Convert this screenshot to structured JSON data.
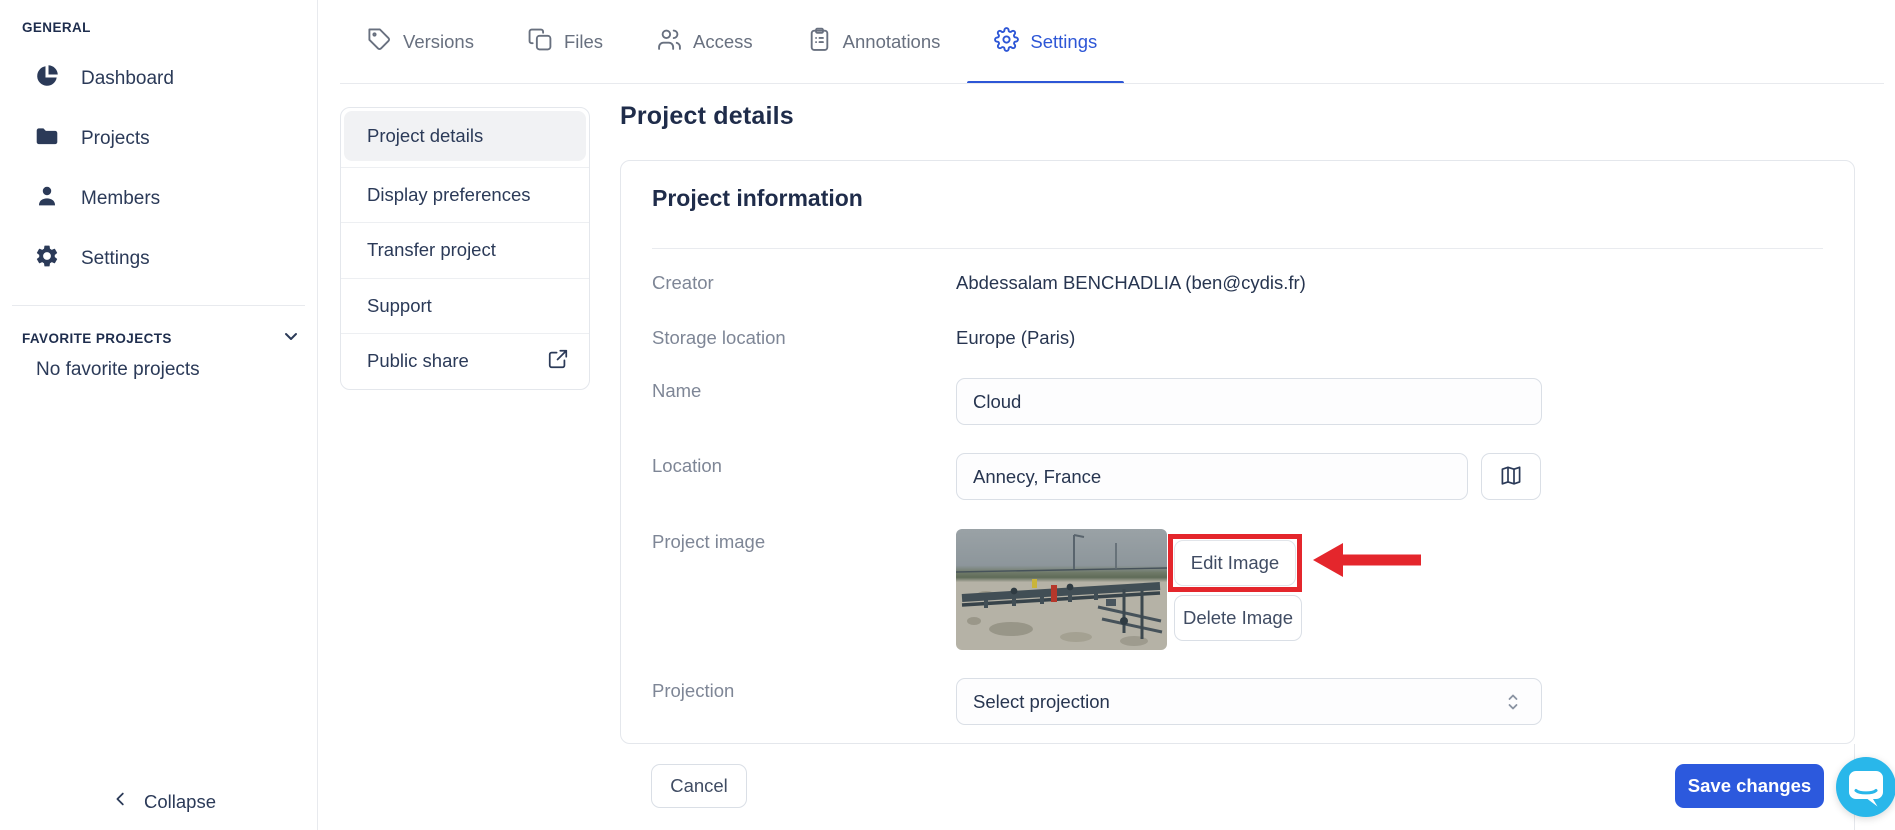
{
  "colors": {
    "accent_blue": "#2d56d6",
    "save_button_blue": "#2c59dd",
    "annotation_red": "#e4262c",
    "chat_bubble_cyan": "#29b7ea",
    "text_navy": "#273550",
    "label_gray": "#7e8696"
  },
  "sidebar": {
    "section_general": "GENERAL",
    "items": [
      {
        "label": "Dashboard",
        "icon": "dashboard-pie-icon"
      },
      {
        "label": "Projects",
        "icon": "folder-icon"
      },
      {
        "label": "Members",
        "icon": "person-icon"
      },
      {
        "label": "Settings",
        "icon": "gear-icon"
      }
    ],
    "section_favorites": "FAVORITE PROJECTS",
    "favorites_empty": "No favorite projects",
    "collapse_label": "Collapse"
  },
  "tabs": [
    {
      "label": "Versions",
      "icon": "tag-icon",
      "active": false
    },
    {
      "label": "Files",
      "icon": "copy-icon",
      "active": false
    },
    {
      "label": "Access",
      "icon": "users-icon",
      "active": false
    },
    {
      "label": "Annotations",
      "icon": "clipboard-icon",
      "active": false
    },
    {
      "label": "Settings",
      "icon": "gear-icon",
      "active": true
    }
  ],
  "subnav": {
    "items": [
      {
        "label": "Project details",
        "active": true
      },
      {
        "label": "Display preferences",
        "active": false
      },
      {
        "label": "Transfer project",
        "active": false
      },
      {
        "label": "Support",
        "active": false
      },
      {
        "label": "Public share",
        "active": false,
        "icon": "external-link-icon"
      }
    ]
  },
  "main": {
    "page_title": "Project details",
    "card_title": "Project information",
    "creator_label": "Creator",
    "creator_value": "Abdessalam BENCHADLIA (ben@cydis.fr)",
    "storage_label": "Storage location",
    "storage_value": "Europe (Paris)",
    "name_label": "Name",
    "name_value": "Cloud",
    "location_label": "Location",
    "location_value": "Annecy, France",
    "image_label": "Project image",
    "edit_image_button": "Edit Image",
    "delete_image_button": "Delete Image",
    "projection_label": "Projection",
    "projection_placeholder": "Select projection",
    "cancel_button": "Cancel",
    "save_button": "Save changes"
  }
}
